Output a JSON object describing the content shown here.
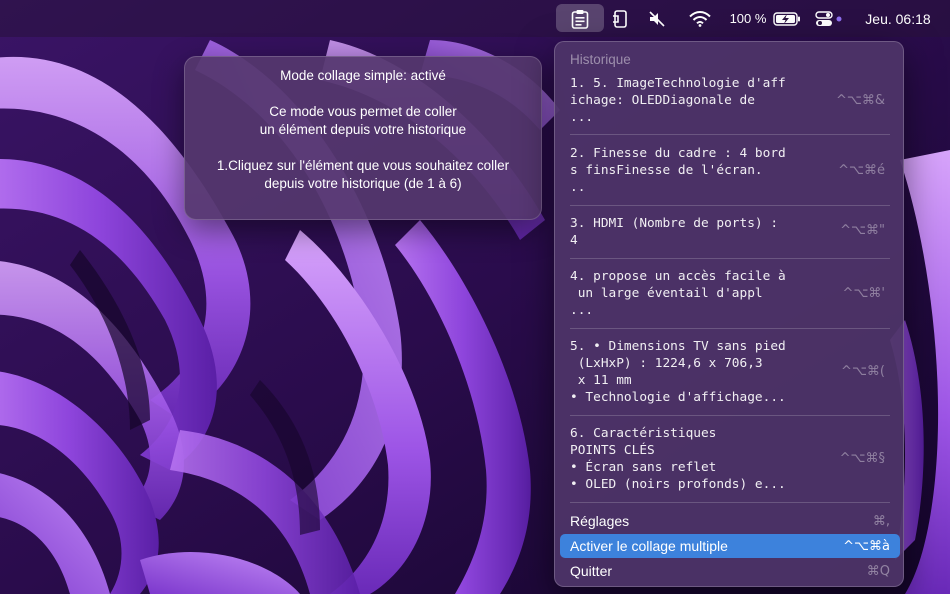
{
  "menubar": {
    "battery_percent": "100 %",
    "clock": "Jeu. 06:18",
    "icons": [
      "clipboard-icon",
      "phone-icon",
      "mute-icon",
      "wifi-icon",
      "battery-charging-icon",
      "control-center-icon",
      "status-dot-icon"
    ]
  },
  "tooltip": {
    "title": "Mode collage simple: activé",
    "line1": "Ce mode vous permet de coller",
    "line2": "un élément depuis votre historique",
    "line3": "1.Cliquez sur l'élément que vous souhaitez coller",
    "line4": "depuis votre historique (de 1 à 6)"
  },
  "menu": {
    "header": "Historique",
    "items": [
      {
        "text": "1. 5. ImageTechnologie d'aff\nichage: OLEDDiagonale de\n...",
        "shortcut": "^⌥⌘&"
      },
      {
        "text": "2. Finesse du cadre : 4 bord\ns finsFinesse de l'écran.\n..",
        "shortcut": "^⌥⌘é"
      },
      {
        "text": "3. HDMI (Nombre de ports) :\n4",
        "shortcut": "^⌥⌘\""
      },
      {
        "text": "4. propose un accès facile à\n un large éventail d'appl\n...",
        "shortcut": "^⌥⌘'"
      },
      {
        "text": "5. • Dimensions TV sans pied\n (LxHxP) : 1224,6 x 706,3\n x 11 mm\n• Technologie d'affichage...",
        "shortcut": "^⌥⌘("
      },
      {
        "text": "6. Caractéristiques\nPOINTS CLÉS\n• Écran sans reflet\n• OLED (noirs profonds) e...",
        "shortcut": "^⌥⌘§"
      }
    ],
    "actions": {
      "settings": {
        "label": "Réglages",
        "shortcut": "⌘,"
      },
      "multi": {
        "label": "Activer le collage multiple",
        "shortcut": "^⌥⌘à"
      },
      "quit": {
        "label": "Quitter",
        "shortcut": "⌘Q"
      }
    }
  },
  "colors": {
    "accent": "#3d82dc",
    "menu_bg": "#4e3468",
    "wallpaper": "#7a3cc8"
  }
}
